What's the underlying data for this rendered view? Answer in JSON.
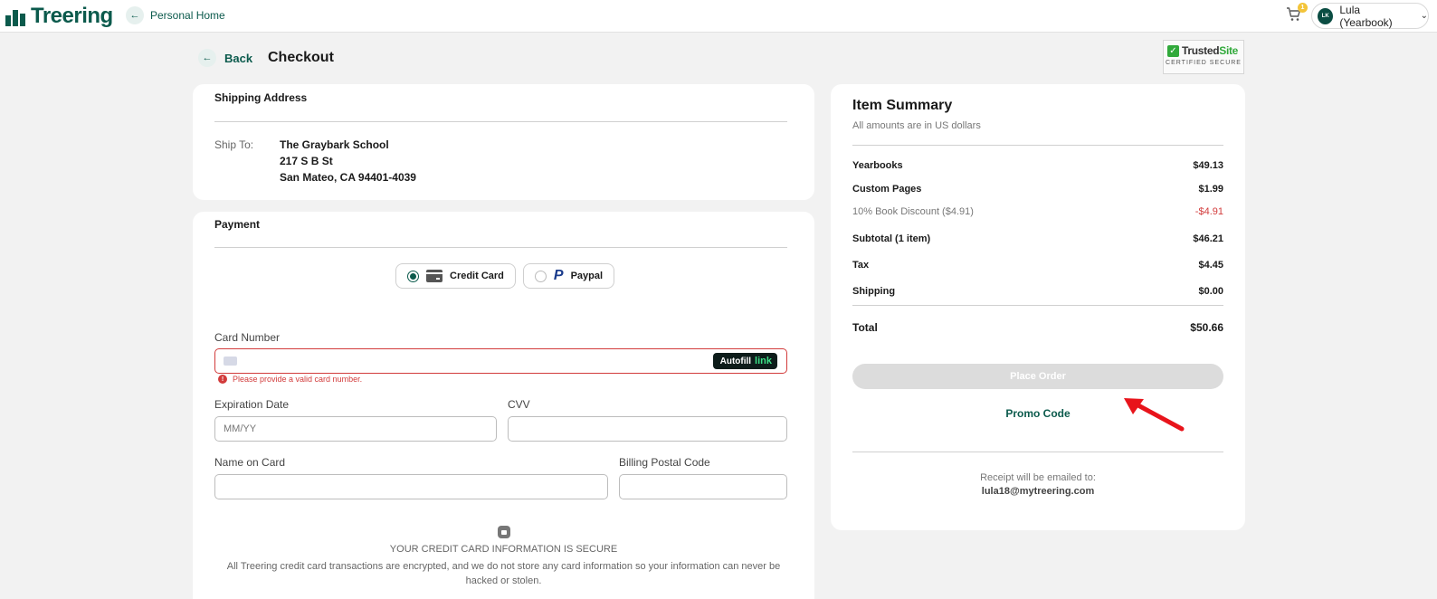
{
  "nav": {
    "logo": "Treering",
    "home_link": "Personal Home",
    "cart_count": "1",
    "account_initials": "LK",
    "account_name": "Lula (Yearbook)"
  },
  "header": {
    "back": "Back",
    "title": "Checkout",
    "trusted_name_a": "Trusted",
    "trusted_name_b": "Site",
    "trusted_sub": "CERTIFIED SECURE"
  },
  "shipping": {
    "title": "Shipping Address",
    "label": "Ship To:",
    "line1": "The Graybark School",
    "line2": "217 S B St",
    "line3": "San Mateo, CA 94401-4039"
  },
  "payment": {
    "title": "Payment",
    "options": [
      "Credit Card",
      "Paypal"
    ],
    "selected": "Credit Card",
    "card_number_label": "Card Number",
    "autofill": "Autofill",
    "autofill_link": "link",
    "error": "Please provide a valid card number.",
    "exp_label": "Expiration Date",
    "exp_placeholder": "MM/YY",
    "cvv_label": "CVV",
    "name_label": "Name on Card",
    "postal_label": "Billing Postal Code",
    "secure_title": "YOUR CREDIT CARD INFORMATION IS SECURE",
    "secure_desc": "All Treering credit card transactions are encrypted, and we do not store any card information so your information can never be hacked or stolen."
  },
  "summary": {
    "title": "Item Summary",
    "subtitle": "All amounts are in US dollars",
    "items": [
      {
        "label": "Yearbooks",
        "amount": "$49.13"
      },
      {
        "label": "Custom Pages",
        "amount": "$1.99"
      },
      {
        "label": "10% Book Discount ($4.91)",
        "amount": "-$4.91"
      },
      {
        "label": "Subtotal (1 item)",
        "amount": "$46.21"
      },
      {
        "label": "Tax",
        "amount": "$4.45"
      },
      {
        "label": "Shipping",
        "amount": "$0.00"
      }
    ],
    "total_label": "Total",
    "total_amount": "$50.66",
    "place_order": "Place Order",
    "promo": "Promo Code",
    "receipt_label": "Receipt will be emailed to:",
    "receipt_email": "lula18@mytreering.com"
  },
  "colors": {
    "brand": "#0b5a4c",
    "error": "#d23b3b",
    "annotation_arrow": "#e8141b"
  }
}
